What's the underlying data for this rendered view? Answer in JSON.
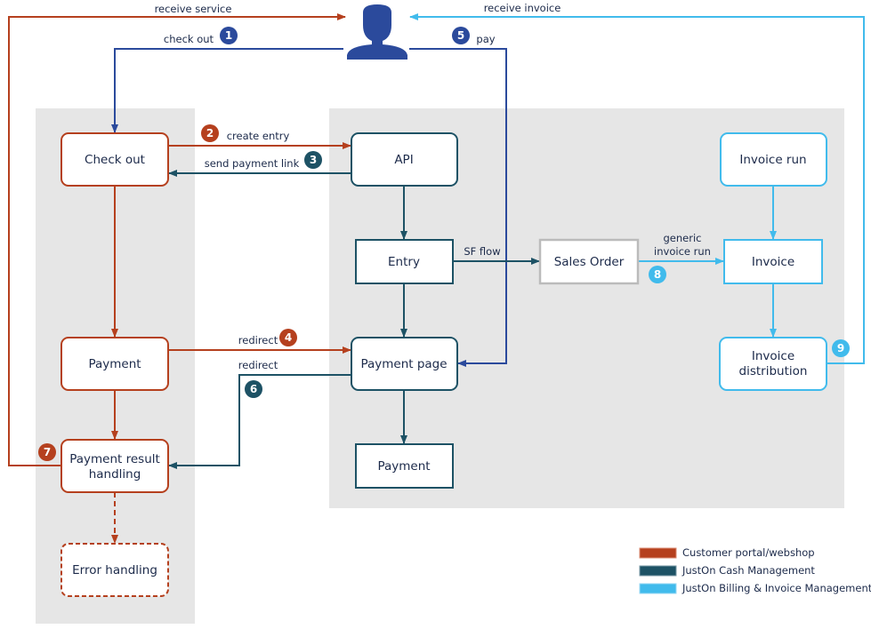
{
  "colors": {
    "customer_portal": "#B5401E",
    "cash_management": "#1D5265",
    "billing": "#41BBEC",
    "user": "#2B4A9C",
    "sales_order": "#BBBBBB",
    "panel": "#E6E6E6"
  },
  "actor": {
    "icon": "user-icon"
  },
  "nodes": {
    "check_out": "Check out",
    "payment_portal": "Payment",
    "payment_result_1": "Payment result",
    "payment_result_2": "handling",
    "error_handling": "Error handling",
    "api": "API",
    "entry": "Entry",
    "payment_page": "Payment page",
    "payment_cash": "Payment",
    "sales_order": "Sales Order",
    "invoice_run": "Invoice run",
    "invoice": "Invoice",
    "invoice_distribution_1": "Invoice",
    "invoice_distribution_2": "distribution"
  },
  "edges": {
    "receive_service": "receive service",
    "receive_invoice": "receive invoice",
    "check_out": "check out",
    "pay": "pay",
    "create_entry": "create entry",
    "send_payment_link": "send payment link",
    "redirect_4": "redirect",
    "redirect_6": "redirect",
    "sf_flow": "SF flow",
    "generic_invoice_run_1": "generic",
    "generic_invoice_run_2": "invoice run"
  },
  "badges": [
    "1",
    "2",
    "3",
    "4",
    "5",
    "6",
    "7",
    "8",
    "9"
  ],
  "legend": [
    {
      "label": "Customer portal/webshop",
      "color": "#B5401E"
    },
    {
      "label": "JustOn Cash Management",
      "color": "#1D5265"
    },
    {
      "label": "JustOn Billing & Invoice Management",
      "color": "#41BBEC"
    }
  ]
}
